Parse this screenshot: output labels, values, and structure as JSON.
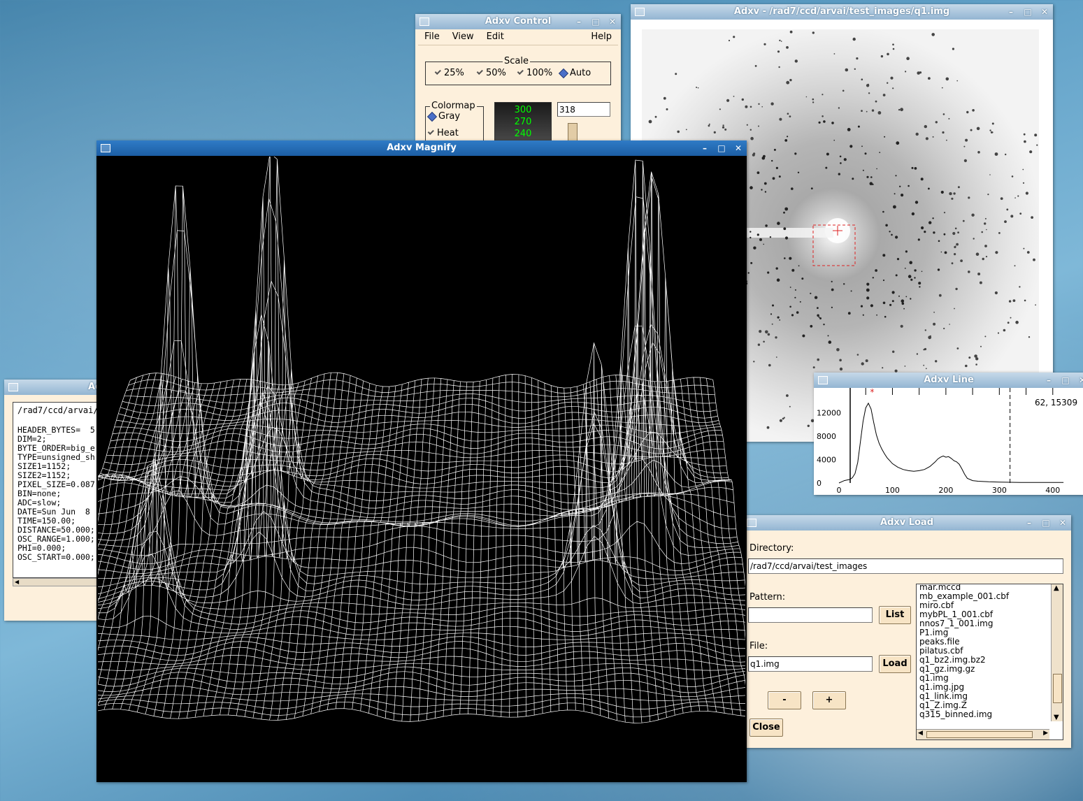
{
  "control": {
    "title": "Adxv Control",
    "menu": [
      "File",
      "View",
      "Edit"
    ],
    "help": "Help",
    "scale": {
      "label": "Scale",
      "options": [
        "25%",
        "50%",
        "100%",
        "Auto"
      ],
      "selected": "Auto"
    },
    "colormap": {
      "label": "Colormap",
      "options": [
        "Gray",
        "Heat"
      ],
      "selected": "Gray"
    },
    "levels": [
      "300",
      "270",
      "240"
    ],
    "value": "318"
  },
  "viewer": {
    "title": "Adxv - /rad7/ccd/arvai/test_images/q1.img"
  },
  "magnify": {
    "title": "Adxv Magnify"
  },
  "header_win": {
    "title": "Adxv",
    "path": "/rad7/ccd/arvai/",
    "lines": [
      "HEADER_BYTES=  5",
      "DIM=2;",
      "BYTE_ORDER=big_e",
      "TYPE=unsigned_sh",
      "SIZE1=1152;",
      "SIZE2=1152;",
      "PIXEL_SIZE=0.087",
      "BIN=none;",
      "ADC=slow;",
      "DATE=Sun Jun  8",
      "TIME=150.00;",
      "DISTANCE=50.000;",
      "OSC_RANGE=1.000;",
      "PHI=0.000;",
      "OSC_START=0.000;"
    ]
  },
  "line": {
    "title": "Adxv Line",
    "readout": "62, 15309",
    "chart_data": {
      "type": "line",
      "x": [
        0,
        5,
        10,
        15,
        20,
        25,
        30,
        35,
        40,
        45,
        50,
        55,
        60,
        65,
        70,
        75,
        80,
        85,
        90,
        95,
        100,
        110,
        120,
        130,
        140,
        150,
        160,
        170,
        180,
        185,
        190,
        195,
        200,
        205,
        210,
        215,
        220,
        225,
        230,
        235,
        240,
        250,
        260,
        280,
        300,
        320,
        340,
        360,
        380,
        400,
        420
      ],
      "y": [
        0,
        200,
        400,
        500,
        600,
        900,
        1600,
        3500,
        7000,
        10500,
        12800,
        13600,
        12600,
        10300,
        8200,
        6800,
        5800,
        5000,
        4300,
        3800,
        3300,
        2700,
        2300,
        2100,
        2000,
        2100,
        2300,
        2800,
        3600,
        4100,
        4400,
        4600,
        4400,
        4500,
        4200,
        3800,
        3600,
        3200,
        2400,
        1500,
        800,
        400,
        300,
        200,
        150,
        120,
        100,
        100,
        100,
        100,
        100
      ],
      "marker_x": 62,
      "cursor_x": 320,
      "xlim": [
        0,
        450
      ],
      "ylim": [
        0,
        15500
      ],
      "xticks": [
        "0",
        "100",
        "200",
        "300",
        "400"
      ],
      "yticks": [
        "0",
        "4000",
        "8000",
        "12000"
      ]
    }
  },
  "load": {
    "title": "Adxv Load",
    "directory_label": "Directory:",
    "directory": "/rad7/ccd/arvai/test_images",
    "pattern_label": "Pattern:",
    "pattern": "",
    "list_button": "List",
    "file_label": "File:",
    "file": "q1.img",
    "load_button": "Load",
    "minus_button": "-",
    "plus_button": "+",
    "close_button": "Close",
    "files": [
      "mar.mccd",
      "mb_example_001.cbf",
      "miro.cbf",
      "mybPL_1_001.cbf",
      "nnos7_1_001.img",
      "P1.img",
      "peaks.file",
      "pilatus.cbf",
      "q1_bz2.img.bz2",
      "q1_gz.img.gz",
      "q1.img",
      "q1.img.jpg",
      "q1_link.img",
      "q1_Z.img.Z",
      "q315_binned.img"
    ]
  },
  "colors": {
    "accent": "#1c5ea4",
    "panel": "#fdf0dc",
    "green": "#00ff00"
  }
}
